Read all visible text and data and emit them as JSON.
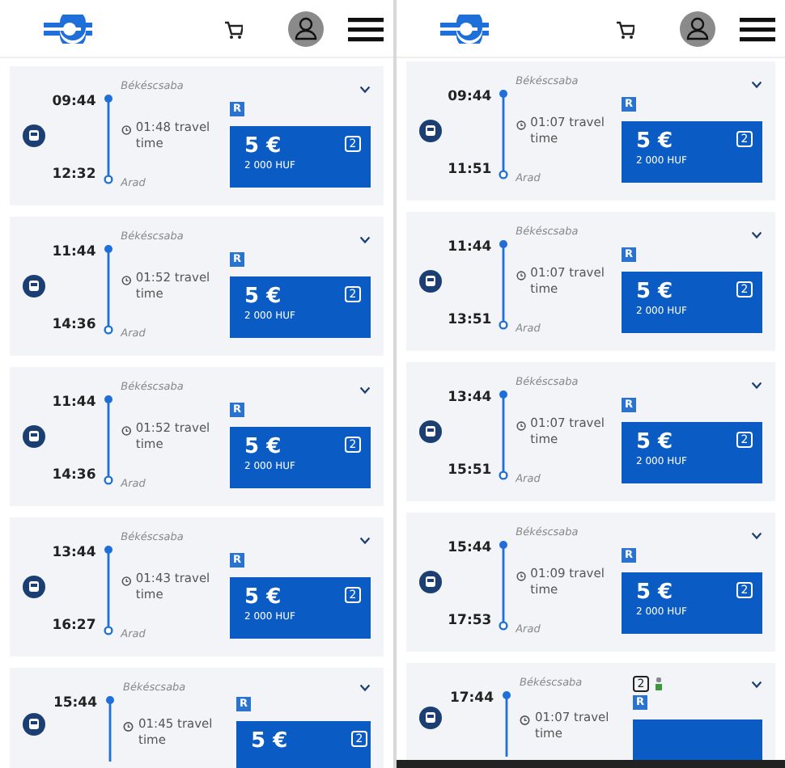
{
  "panels": [
    {
      "cards": [
        {
          "departure": "09:44",
          "from": "Békéscsaba",
          "duration": "01:48",
          "duration_label": "travel time",
          "arrival": "12:32",
          "to": "Arad",
          "train_badge": "R",
          "price": "5 €",
          "price_huf": "2 000 HUF",
          "class": "2"
        },
        {
          "departure": "11:44",
          "from": "Békéscsaba",
          "duration": "01:52",
          "duration_label": "travel time",
          "arrival": "14:36",
          "to": "Arad",
          "train_badge": "R",
          "price": "5 €",
          "price_huf": "2 000 HUF",
          "class": "2"
        },
        {
          "departure": "11:44",
          "from": "Békéscsaba",
          "duration": "01:52",
          "duration_label": "travel time",
          "arrival": "14:36",
          "to": "Arad",
          "train_badge": "R",
          "price": "5 €",
          "price_huf": "2 000 HUF",
          "class": "2"
        },
        {
          "departure": "13:44",
          "from": "Békéscsaba",
          "duration": "01:43",
          "duration_label": "travel time",
          "arrival": "16:27",
          "to": "Arad",
          "train_badge": "R",
          "price": "5 €",
          "price_huf": "2 000 HUF",
          "class": "2"
        },
        {
          "departure": "15:44",
          "from": "Békéscsaba",
          "duration": "01:45",
          "duration_label": "travel time",
          "train_badge": "R",
          "price": "5 €",
          "class": "2"
        }
      ]
    },
    {
      "cards": [
        {
          "departure": "09:44",
          "from": "Békéscsaba",
          "duration": "01:07",
          "duration_label": "travel time",
          "arrival": "11:51",
          "to": "Arad",
          "train_badge": "R",
          "price": "5 €",
          "price_huf": "2 000 HUF",
          "class": "2"
        },
        {
          "departure": "11:44",
          "from": "Békéscsaba",
          "duration": "01:07",
          "duration_label": "travel time",
          "arrival": "13:51",
          "to": "Arad",
          "train_badge": "R",
          "price": "5 €",
          "price_huf": "2 000 HUF",
          "class": "2"
        },
        {
          "departure": "13:44",
          "from": "Békéscsaba",
          "duration": "01:07",
          "duration_label": "travel time",
          "arrival": "15:51",
          "to": "Arad",
          "train_badge": "R",
          "price": "5 €",
          "price_huf": "2 000 HUF",
          "class": "2"
        },
        {
          "departure": "15:44",
          "from": "Békéscsaba",
          "duration": "01:09",
          "duration_label": "travel time",
          "arrival": "17:53",
          "to": "Arad",
          "train_badge": "R",
          "price": "5 €",
          "price_huf": "2 000 HUF",
          "class": "2"
        },
        {
          "departure": "17:44",
          "from": "Békéscsaba",
          "duration": "01:07",
          "duration_label": "travel time",
          "train_badge": "R",
          "top_badge": "2"
        }
      ]
    }
  ]
}
